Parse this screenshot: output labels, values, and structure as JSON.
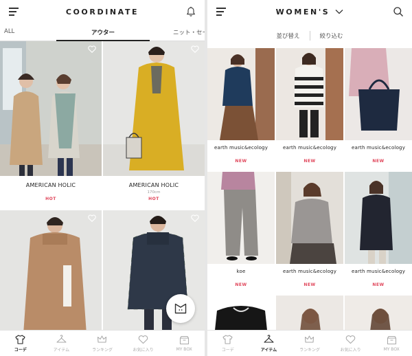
{
  "left_screen": {
    "header": {
      "title": "COORDINATE",
      "menu_icon": "hamburger-icon",
      "right_icon": "bell-icon"
    },
    "tabs": [
      {
        "label": "ALL",
        "active": false
      },
      {
        "label": "アウター",
        "active": true
      },
      {
        "label": "ニット・セー",
        "active": false
      }
    ],
    "cards": [
      {
        "brand": "AMERICAN HOLIC",
        "sub": "",
        "badge": "HOT"
      },
      {
        "brand": "AMERICAN HOLIC",
        "sub": "170cm",
        "badge": "HOT"
      },
      {
        "brand": "",
        "sub": "",
        "badge": ""
      },
      {
        "brand": "",
        "sub": "",
        "badge": ""
      }
    ],
    "fab_icon": "closet-icon",
    "nav": [
      {
        "label": "コーデ",
        "icon": "shirt-icon",
        "active": true
      },
      {
        "label": "アイテム",
        "icon": "hanger-icon",
        "active": false
      },
      {
        "label": "ランキング",
        "icon": "crown-icon",
        "active": false
      },
      {
        "label": "お気に入り",
        "icon": "heart-icon",
        "active": false
      },
      {
        "label": "MY BOX",
        "icon": "box-icon",
        "active": false
      }
    ]
  },
  "right_screen": {
    "header": {
      "title": "WOMEN'S",
      "menu_icon": "hamburger-icon",
      "right_icon": "search-icon"
    },
    "sort_label": "並び替え",
    "filter_label": "絞り込む",
    "items": [
      {
        "brand": "earth music&ecology",
        "badge": "NEW"
      },
      {
        "brand": "earth music&ecology",
        "badge": "NEW"
      },
      {
        "brand": "earth music&ecology",
        "badge": "NEW"
      },
      {
        "brand": "koe",
        "badge": "NEW"
      },
      {
        "brand": "earth music&ecology",
        "badge": "NEW"
      },
      {
        "brand": "earth music&ecology",
        "badge": "NEW"
      },
      {
        "brand": "",
        "badge": ""
      },
      {
        "brand": "",
        "badge": ""
      },
      {
        "brand": "",
        "badge": ""
      }
    ],
    "nav": [
      {
        "label": "コーデ",
        "icon": "shirt-icon",
        "active": false
      },
      {
        "label": "アイテム",
        "icon": "hanger-icon",
        "active": true
      },
      {
        "label": "ランキング",
        "icon": "crown-icon",
        "active": false
      },
      {
        "label": "お気に入り",
        "icon": "heart-icon",
        "active": false
      },
      {
        "label": "MY BOX",
        "icon": "box-icon",
        "active": false
      }
    ]
  },
  "colors": {
    "accent": "#e0455a",
    "text": "#222222",
    "inactive": "#aaaaaa"
  }
}
